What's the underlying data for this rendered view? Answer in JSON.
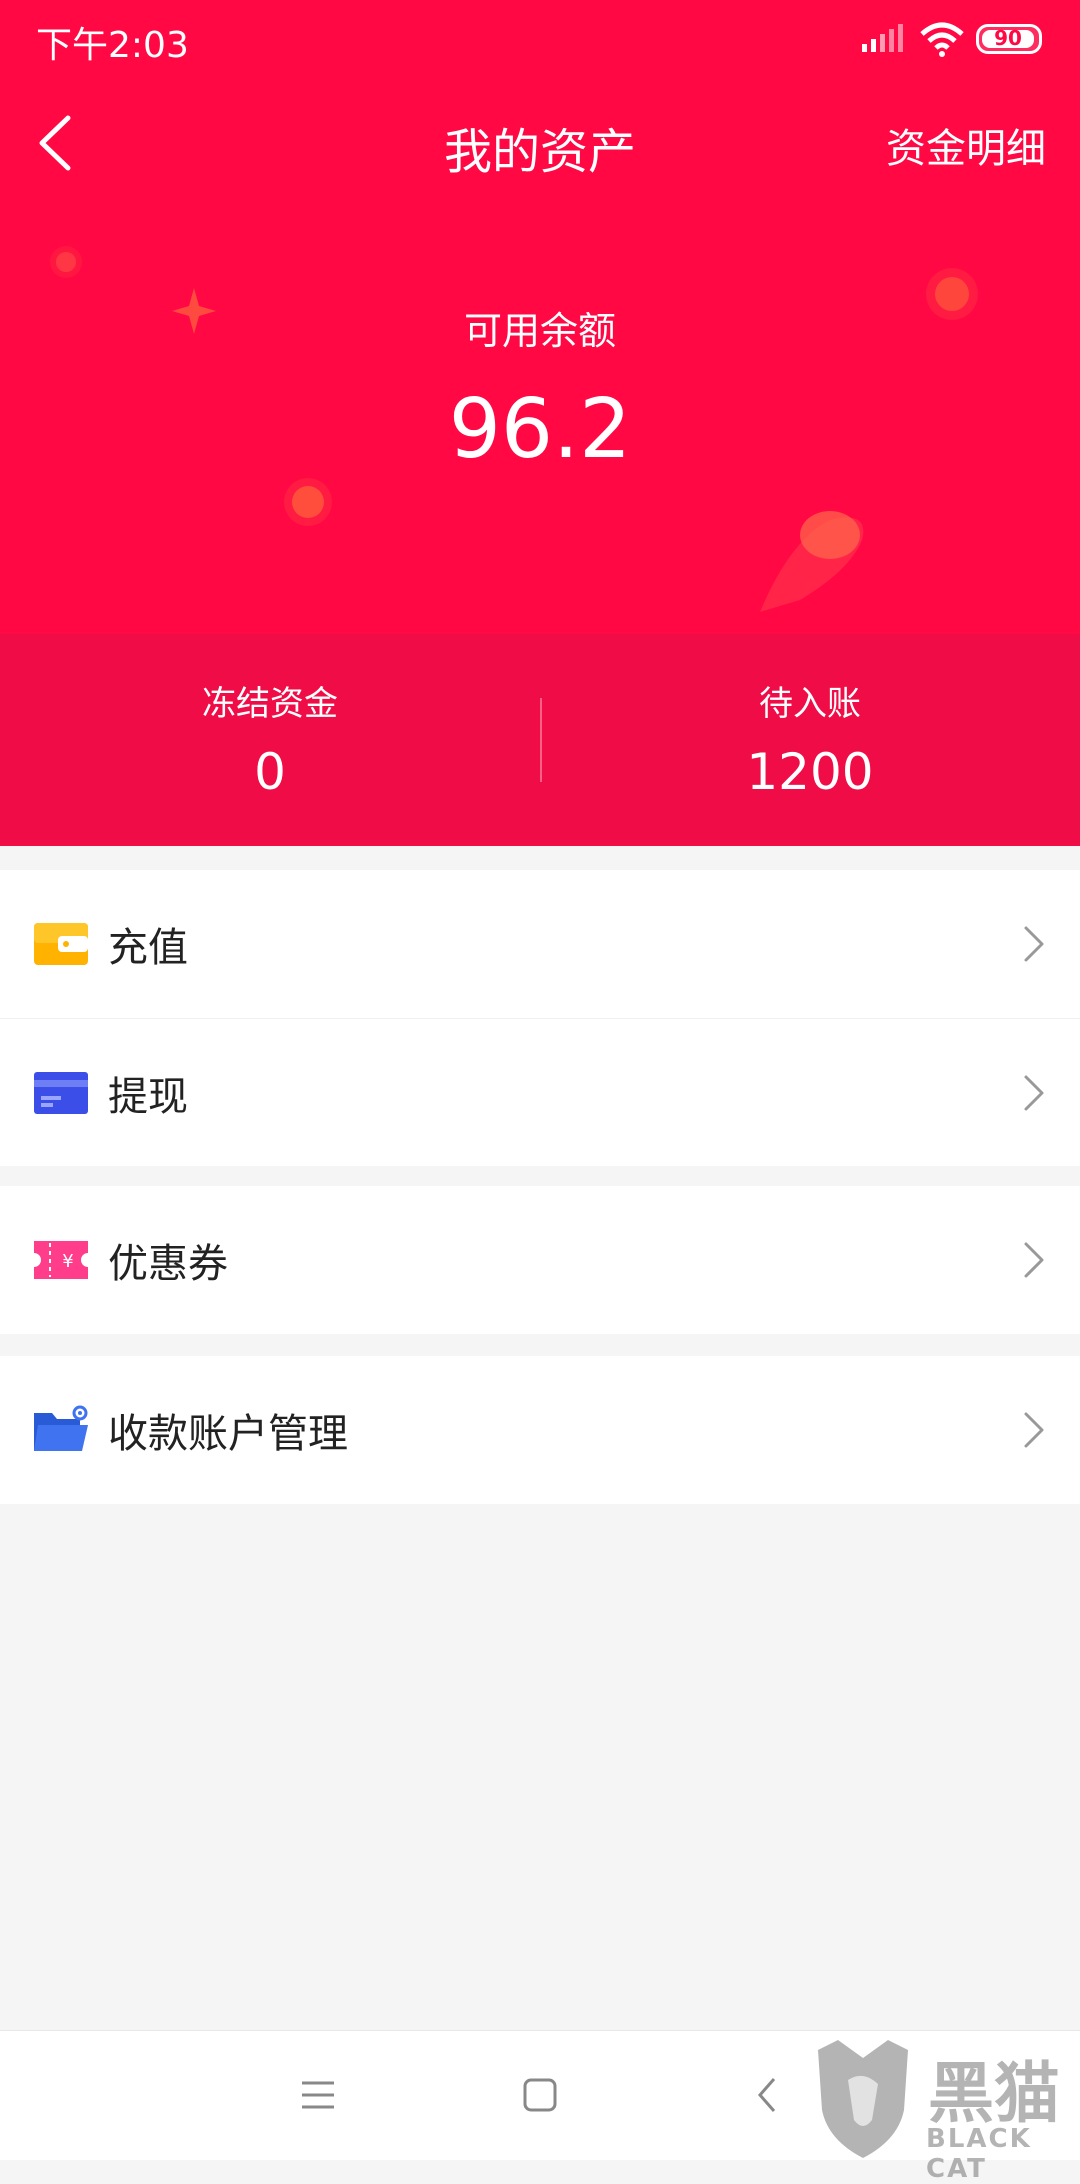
{
  "status_bar": {
    "time": "下午2:03",
    "battery": "90"
  },
  "header": {
    "title": "我的资产",
    "detail_link": "资金明细"
  },
  "balance": {
    "label": "可用余额",
    "value": "96.2"
  },
  "stats": {
    "frozen": {
      "label": "冻结资金",
      "value": "0"
    },
    "pending": {
      "label": "待入账",
      "value": "1200"
    }
  },
  "menu": {
    "recharge": {
      "label": "充值",
      "icon": "wallet-icon"
    },
    "withdraw": {
      "label": "提现",
      "icon": "card-icon"
    },
    "coupon": {
      "label": "优惠券",
      "icon": "coupon-icon"
    },
    "accounts": {
      "label": "收款账户管理",
      "icon": "folder-settings-icon"
    }
  },
  "watermark": {
    "main": "黑猫",
    "sub": "BLACK CAT"
  },
  "colors": {
    "brand": "#ff0844",
    "stats_bg": "#f00c46",
    "page_bg": "#f5f5f5"
  }
}
